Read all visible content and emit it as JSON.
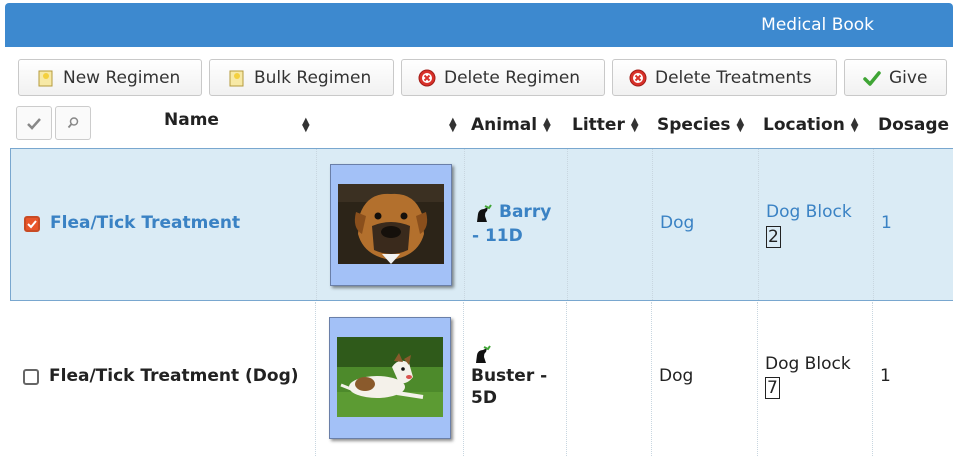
{
  "window": {
    "title": "Medical Book"
  },
  "toolbar": {
    "new_regimen": "New Regimen",
    "bulk_regimen": "Bulk Regimen",
    "delete_regimen": "Delete Regimen",
    "delete_treatments": "Delete Treatments",
    "give": "Give"
  },
  "columns": {
    "name": "Name",
    "animal": "Animal",
    "litter": "Litter",
    "species": "Species",
    "location": "Location",
    "dosage": "Dosage"
  },
  "rows": [
    {
      "selected": true,
      "name": "Flea/Tick Treatment",
      "photo_icon": "boxer-dog-photo",
      "animal_line1": "Barry",
      "animal_line2": "- 11D",
      "litter": "",
      "species": "Dog",
      "location": "Dog Block",
      "location_unit": "2",
      "dosage": "1"
    },
    {
      "selected": false,
      "name": "Flea/Tick Treatment (Dog)",
      "photo_icon": "jack-russell-dog-photo",
      "animal_line1": "Buster -",
      "animal_line2": "5D",
      "litter": "",
      "species": "Dog",
      "location": "Dog Block",
      "location_unit": "7",
      "dosage": "1"
    }
  ],
  "colors": {
    "titlebar": "#3d89cf",
    "selected_row": "#daebf5",
    "link": "#3a82c4",
    "checkbox_checked": "#e8552a"
  }
}
